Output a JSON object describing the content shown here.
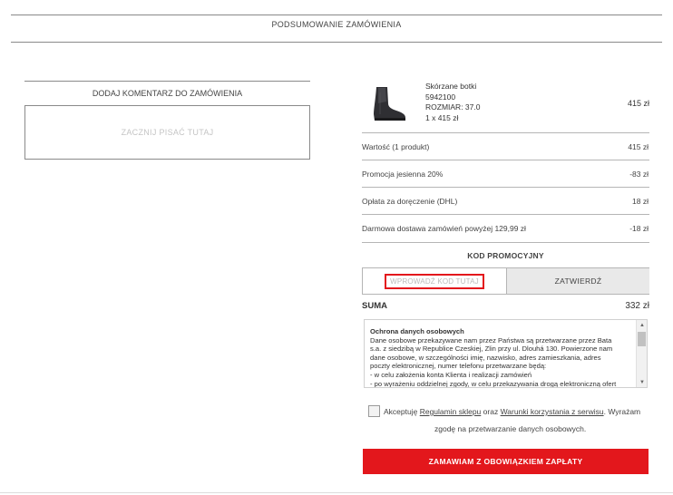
{
  "header": {
    "title": "PODSUMOWANIE ZAMÓWIENIA"
  },
  "comment": {
    "title": "DODAJ KOMENTARZ DO ZAMÓWIENIA",
    "placeholder": "ZACZNIJ PISAĆ TUTAJ"
  },
  "product": {
    "name": "Skórzane botki",
    "code": "5942100",
    "size": "ROZMIAR: 37.0",
    "quantity": "1 x 415 zł",
    "price": "415 zł",
    "image_icon": "ankle-boot-icon"
  },
  "summary_rows": [
    {
      "label": "Wartość (1 produkt)",
      "value": "415 zł"
    },
    {
      "label": "Promocja jesienna 20%",
      "value": "-83 zł"
    },
    {
      "label": "Opłata za doręczenie (DHL)",
      "value": "18 zł"
    },
    {
      "label": "Darmowa dostawa zamówień powyżej 129,99 zł",
      "value": "-18 zł"
    }
  ],
  "promo": {
    "title": "KOD PROMOCYJNY",
    "placeholder": "WPROWADŹ KOD TUTAJ",
    "button": "ZATWIERDŹ"
  },
  "total": {
    "label": "SUMA",
    "value": "332 zł"
  },
  "privacy": {
    "heading": "Ochrona danych osobowych",
    "lines": [
      "Dane osobowe przekazywane nam przez Państwa są przetwarzane przez Bata",
      "s.a. z siedzibą w Republice Czeskiej, Zlin przy ul. Dlouhá 130. Powierzone nam",
      "dane osobowe, w szczególności imię, nazwisko, adres zamieszkania, adres",
      "poczty elektronicznej, numer telefonu przetwarzane będą:",
      "- w celu założenia konta Klienta i realizacji zamówień",
      "- po wyrażeniu oddzielnej zgody, w celu przekazywania drogą elektroniczną ofert"
    ]
  },
  "accept": {
    "prefix": "Akceptuję",
    "link1": "Regulamin sklepu",
    "middle": "oraz",
    "link2": "Warunki korzystania z serwisu",
    "suffix": ". Wyrażam",
    "line2": "zgodę na przetwarzanie danych osobowych."
  },
  "order_button": "ZAMAWIAM Z OBOWIĄZKIEM ZAPŁATY",
  "colors": {
    "accent": "#e3171c",
    "border": "#b5b5b5"
  }
}
